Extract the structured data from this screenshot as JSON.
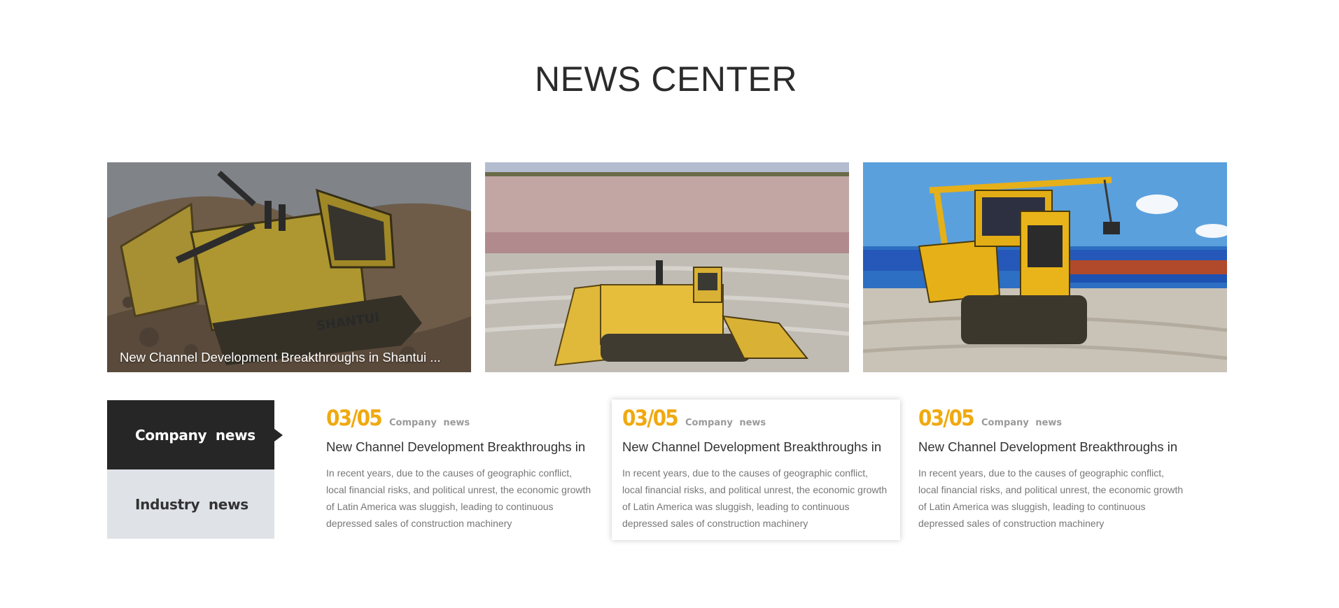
{
  "section": {
    "title": "NEWS CENTER"
  },
  "photos": [
    {
      "caption": "New Channel Development Breakthroughs in Shantui ...",
      "icon": "bulldozer-quarry-photo"
    },
    {
      "caption": "",
      "icon": "bulldozer-field-photo"
    },
    {
      "caption": "",
      "icon": "pipelayer-photo"
    }
  ],
  "tabs": [
    {
      "label": "Company  news",
      "state": "active"
    },
    {
      "label": "Industry  news",
      "state": "inactive"
    }
  ],
  "cards": [
    {
      "date": "03/05",
      "category": "Company  news",
      "headline": "New Channel Development Breakthroughs in",
      "desc": "In recent years, due to the causes of geographic conflict, local financial risks, and political unrest, the economic growth of Latin America was sluggish, leading to continuous depressed sales of construction machinery"
    },
    {
      "date": "03/05",
      "category": "Company  news",
      "headline": "New Channel Development Breakthroughs in",
      "desc": "In recent years, due to the causes of geographic conflict, local financial risks, and political unrest, the economic growth of Latin America was sluggish, leading to continuous depressed sales of construction machinery"
    },
    {
      "date": "03/05",
      "category": "Company  news",
      "headline": "New Channel Development Breakthroughs in",
      "desc": "In recent years, due to the causes of geographic conflict, local financial risks, and political unrest, the economic growth of Latin America was sluggish, leading to continuous depressed sales of construction machinery"
    }
  ],
  "colors": {
    "accent": "#f0a90f",
    "tab_active": "#262626",
    "tab_inactive": "#dfe3e8"
  }
}
